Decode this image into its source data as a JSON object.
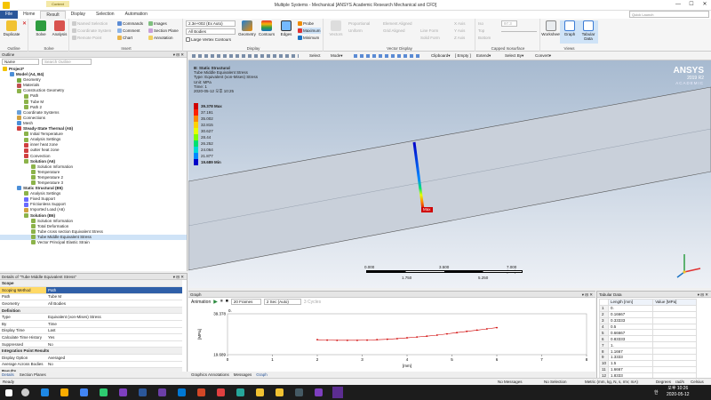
{
  "window": {
    "title": "Multiple Systems - Mechanical [ANSYS Academic Research Mechanical and CFD]",
    "context_tab": "Context",
    "ctl_min": "—",
    "ctl_max": "☐",
    "ctl_close": "✕"
  },
  "tabs": [
    "File",
    "Home",
    "Result",
    "Display",
    "Selection",
    "Automation"
  ],
  "search_placeholder": "Quick Launch",
  "ribbon": {
    "outline": {
      "label": "Outline",
      "duplicate": "Duplicate",
      "delete_icon": "✕"
    },
    "solve": {
      "label": "Solve",
      "solve": "Solve",
      "analysis": "Analysis"
    },
    "insert": {
      "label": "Insert",
      "named_selection": "Named Selection",
      "coordinate_system": "Coordinate System",
      "remote_point": "Remote Point",
      "commands": "Commands",
      "comment": "Comment",
      "chart": "Chart",
      "images": "Images",
      "section_plane": "Section Plane",
      "annotation": "Annotation"
    },
    "display": {
      "label": "Display",
      "scale": "2.3e+002 (Ex Auto)",
      "bodies": "All Bodies",
      "large_vertex": "Large Vertex Contours",
      "geometry": "Geometry",
      "contours": "Contours",
      "edges": "Edges",
      "probe": "Probe",
      "maximum": "Maximum",
      "minimum": "Minimum"
    },
    "vector": {
      "label": "Vector Display",
      "vectors": "Vectors",
      "proportional": "Proportional",
      "uniform": "Uniform",
      "element_aligned": "Element Aligned",
      "grid_aligned": "Grid Aligned",
      "line_form": "Line Form",
      "solid_form": "Solid Form",
      "x_axis": "X Axis",
      "y_axis": "Y Axis",
      "z_axis": "Z Axis"
    },
    "capped": {
      "label": "Capped Isosurface",
      "iso": "Iso",
      "top": "Top",
      "bottom": "Bottom",
      "value": "97.3"
    },
    "views": {
      "label": "Views",
      "worksheet": "Worksheet",
      "graph": "Graph",
      "tabular": "Tabular Data"
    }
  },
  "outline": {
    "title": "Outline",
    "pin": "▾ ⊟ ✕",
    "filter": "Name",
    "search": "Search Outline",
    "items": [
      {
        "t": "Project*",
        "d": 0,
        "b": true,
        "c": "#f2c200"
      },
      {
        "t": "Model (A4, B4)",
        "d": 1,
        "b": true,
        "c": "#4c8fd8"
      },
      {
        "t": "Geometry",
        "d": 2,
        "c": "#7aa940"
      },
      {
        "t": "Materials",
        "d": 2,
        "c": "#c05050"
      },
      {
        "t": "Construction Geometry",
        "d": 2,
        "c": "#8cb34a"
      },
      {
        "t": "Path",
        "d": 3,
        "c": "#8cb34a"
      },
      {
        "t": "Tube M",
        "d": 3,
        "c": "#8cb34a"
      },
      {
        "t": "Path 2",
        "d": 3,
        "c": "#8cb34a"
      },
      {
        "t": "Coordinate Systems",
        "d": 2,
        "c": "#6aa0d8"
      },
      {
        "t": "Connections",
        "d": 2,
        "c": "#d0a040"
      },
      {
        "t": "Mesh",
        "d": 2,
        "c": "#4c8fd8"
      },
      {
        "t": "Steady-State Thermal (A5)",
        "d": 2,
        "b": true,
        "c": "#d04040"
      },
      {
        "t": "Initial Temperature",
        "d": 3,
        "c": "#8cb34a"
      },
      {
        "t": "Analysis Settings",
        "d": 3,
        "c": "#8cb34a"
      },
      {
        "t": "inner heat zone",
        "d": 3,
        "c": "#d04040"
      },
      {
        "t": "outter heat zone",
        "d": 3,
        "c": "#d04040"
      },
      {
        "t": "Convection",
        "d": 3,
        "c": "#d04040"
      },
      {
        "t": "Solution (A6)",
        "d": 3,
        "b": true,
        "c": "#8cb34a"
      },
      {
        "t": "Solution Information",
        "d": 4,
        "c": "#8cb34a"
      },
      {
        "t": "Temperature",
        "d": 4,
        "c": "#8cb34a"
      },
      {
        "t": "Temperature 2",
        "d": 4,
        "c": "#8cb34a"
      },
      {
        "t": "Temperature 3",
        "d": 4,
        "c": "#8cb34a"
      },
      {
        "t": "Static Structural (B5)",
        "d": 2,
        "b": true,
        "c": "#4c8fd8"
      },
      {
        "t": "Analysis Settings",
        "d": 3,
        "c": "#8cb34a"
      },
      {
        "t": "Fixed Support",
        "d": 3,
        "c": "#6a6aff"
      },
      {
        "t": "Frictionless Support",
        "d": 3,
        "c": "#6a6aff"
      },
      {
        "t": "Imported Load (A6)",
        "d": 3,
        "c": "#d0a040"
      },
      {
        "t": "Solution (B6)",
        "d": 3,
        "b": true,
        "c": "#8cb34a"
      },
      {
        "t": "Solution Information",
        "d": 4,
        "c": "#8cb34a"
      },
      {
        "t": "Total Deformation",
        "d": 4,
        "c": "#8cb34a"
      },
      {
        "t": "Tube cross section Equivalent Stress",
        "d": 4,
        "c": "#8cb34a"
      },
      {
        "t": "Tube Middle Equivalent Stress",
        "d": 4,
        "c": "#8cb34a",
        "s": true
      },
      {
        "t": "Vector Principal Elastic Strain",
        "d": 4,
        "c": "#8cb34a"
      }
    ]
  },
  "details": {
    "title": "Details of \"Tube Middle Equivalent Stress\"",
    "pin": "▾ ⊟ ✕",
    "rows": [
      {
        "sec": "Scope"
      },
      {
        "k": "Scoping Method",
        "v": "Path",
        "hl": true
      },
      {
        "k": "Path",
        "v": "Tube M"
      },
      {
        "k": "Geometry",
        "v": "All Bodies"
      },
      {
        "sec": "Definition"
      },
      {
        "k": "Type",
        "v": "Equivalent (von-Mises) Stress"
      },
      {
        "k": "By",
        "v": "Time"
      },
      {
        "k": "Display Time",
        "v": "Last"
      },
      {
        "k": "Calculate Time History",
        "v": "Yes"
      },
      {
        "k": "Suppressed",
        "v": "No"
      },
      {
        "sec": "Integration Point Results"
      },
      {
        "k": "Display Option",
        "v": "Averaged"
      },
      {
        "k": "Average Across Bodies",
        "v": "No"
      },
      {
        "sec": "Results"
      }
    ],
    "bottom_tabs": [
      "Details",
      "Section Planes"
    ]
  },
  "gfx_toolbar": {
    "select": "Select",
    "mode": "Mode▾",
    "clipboard": "Clipboard▾",
    "empty": "[ Empty ]",
    "extend": "Extend▾",
    "select_by": "Select By▾",
    "convert": "Convert▾"
  },
  "viewport": {
    "info": [
      "B: Static Structural",
      "Tube Middle Equivalent Stress",
      "Type: Equivalent (von-Mises) Stress",
      "Unit: MPa",
      "Time: 1",
      "2020-05-12 오후 10:25"
    ],
    "legend": [
      {
        "v": "39.378 Max",
        "c": "#d00000"
      },
      {
        "v": "37.191",
        "c": "#ff2000"
      },
      {
        "v": "35.002",
        "c": "#ff8800"
      },
      {
        "v": "32.815",
        "c": "#ffd200"
      },
      {
        "v": "30.627",
        "c": "#e6ff00"
      },
      {
        "v": "28.44",
        "c": "#80ff00"
      },
      {
        "v": "26.252",
        "c": "#00e070"
      },
      {
        "v": "24.064",
        "c": "#00d8d8"
      },
      {
        "v": "21.877",
        "c": "#0088ff"
      },
      {
        "v": "19.689 Min",
        "c": "#0000c8"
      }
    ],
    "brand": "ANSYS",
    "version": "2019 R2",
    "edition": "ACADEMIC",
    "max_tag": "Max",
    "scale": {
      "t0": "0.000",
      "t1": "3.500",
      "t2": "7.000 (mm)",
      "b1": "1.750",
      "b2": "5.250"
    }
  },
  "graph": {
    "title": "Graph",
    "pin": "▾ ⊟ ✕",
    "animation": "Animation",
    "frames": "20 Frames",
    "secs": "2 Sec (Auto)",
    "cycle": "3 Cycles",
    "tabs": [
      "Graphics Annotations",
      "Messages",
      "Graph"
    ],
    "chart_data": {
      "type": "line",
      "title": "",
      "xlabel": "[mm]",
      "ylabel": "[MPa]",
      "xlim": [
        0,
        8
      ],
      "ylim": [
        19.689,
        39.378
      ],
      "x_ticks": [
        "0",
        "1",
        "2",
        "3",
        "4",
        "5",
        "6",
        "7",
        "8"
      ],
      "y_ticks": [
        "39.378",
        "19.689"
      ],
      "y_top_note": "0.",
      "x": [
        2.0,
        2.22,
        2.44,
        2.67,
        2.89,
        3.11,
        3.33,
        3.56,
        3.78,
        4.0,
        4.22,
        4.44,
        4.67,
        4.89,
        5.11,
        5.33,
        5.56,
        5.78,
        6.0
      ],
      "y": [
        26.9,
        26.7,
        26.6,
        26.6,
        26.6,
        26.7,
        26.9,
        27.1,
        27.4,
        27.8,
        28.2,
        28.6,
        29.1,
        29.7,
        30.3,
        30.9,
        31.5,
        32.1,
        32.7
      ]
    }
  },
  "tabular": {
    "title": "Tabular Data",
    "pin": "▾ ⊟ ✕",
    "headers": [
      "Length [mm]",
      "Value [MPa]"
    ],
    "rows": [
      [
        "1",
        "0."
      ],
      [
        "2",
        "0.16667"
      ],
      [
        "3",
        "0.33333"
      ],
      [
        "4",
        "0.5"
      ],
      [
        "5",
        "0.66667"
      ],
      [
        "6",
        "0.83333"
      ],
      [
        "7",
        "1."
      ],
      [
        "8",
        "1.1667"
      ],
      [
        "9",
        "1.3333"
      ],
      [
        "10",
        "1.5"
      ],
      [
        "11",
        "1.6667"
      ],
      [
        "12",
        "1.8333"
      ]
    ]
  },
  "statusbar": {
    "ready": "Ready",
    "messages": "No Messages",
    "selection": "No Selection",
    "units": "Metric (mm, kg, N, s, mV, mA)",
    "degrees": "Degrees",
    "rads": "rad/s",
    "celsius": "Celsius"
  },
  "taskbar": {
    "lang": "한",
    "time": "오후 10:26",
    "date": "2020-05-12"
  }
}
